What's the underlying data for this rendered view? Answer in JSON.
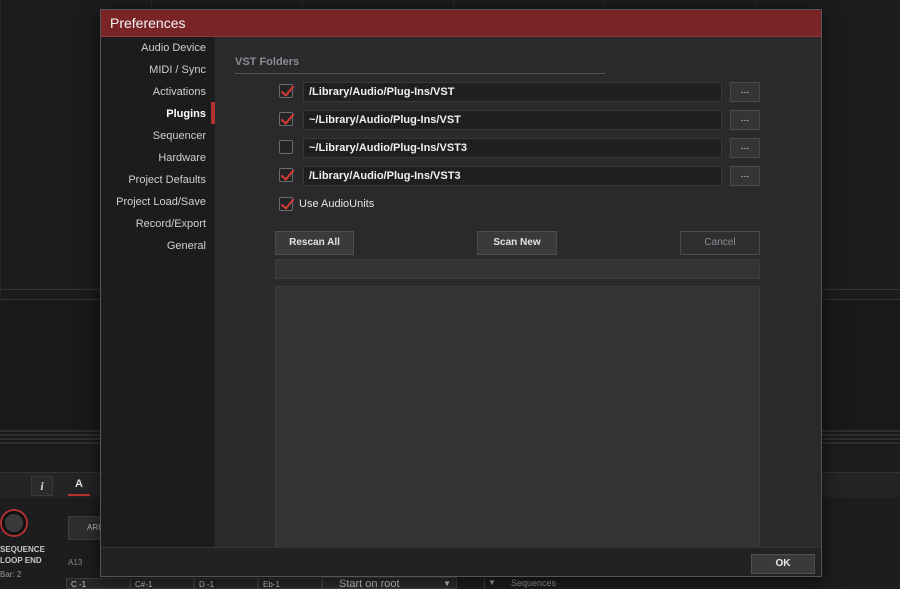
{
  "dialog": {
    "title": "Preferences",
    "ok_label": "OK"
  },
  "sidebar": {
    "items": [
      {
        "label": "Audio Device",
        "active": false
      },
      {
        "label": "MIDI / Sync",
        "active": false
      },
      {
        "label": "Activations",
        "active": false
      },
      {
        "label": "Plugins",
        "active": true
      },
      {
        "label": "Sequencer",
        "active": false
      },
      {
        "label": "Hardware",
        "active": false
      },
      {
        "label": "Project Defaults",
        "active": false
      },
      {
        "label": "Project Load/Save",
        "active": false
      },
      {
        "label": "Record/Export",
        "active": false
      },
      {
        "label": "General",
        "active": false
      }
    ]
  },
  "plugins": {
    "section_title": "VST Folders",
    "folders": [
      {
        "path": "/Library/Audio/Plug-Ins/VST",
        "enabled": true,
        "browse_label": "..."
      },
      {
        "path": "~/Library/Audio/Plug-Ins/VST",
        "enabled": true,
        "browse_label": "..."
      },
      {
        "path": "~/Library/Audio/Plug-Ins/VST3",
        "enabled": false,
        "browse_label": "..."
      },
      {
        "path": "/Library/Audio/Plug-Ins/VST3",
        "enabled": true,
        "browse_label": "..."
      }
    ],
    "use_audiounits": {
      "label": "Use AudioUnits",
      "checked": true
    },
    "rescan_all_label": "Rescan All",
    "scan_new_label": "Scan New",
    "cancel_label": "Cancel"
  },
  "background": {
    "info_label": "i",
    "knob_label_1": "SEQUENCE",
    "knob_label_2": "LOOP END",
    "bar_label": "Bar: 2",
    "tab_label": "A",
    "chip_label": "ARI",
    "track_label": "A13",
    "keys": [
      "C -1",
      "C#-1",
      "D -1",
      "Eb-1"
    ],
    "dropdown_value": "Start on root",
    "sequences_label": "Sequences"
  },
  "colors": {
    "accent": "#b23335",
    "titlebar": "#7a2427",
    "check": "#d53a35"
  }
}
